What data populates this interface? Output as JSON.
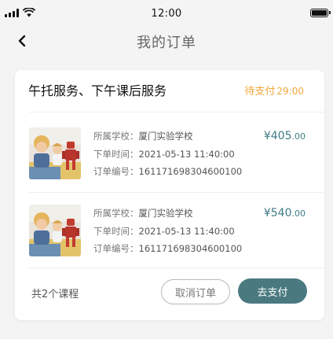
{
  "status_bar": {
    "time": "12:00"
  },
  "nav": {
    "title": "我的订单"
  },
  "order": {
    "title": "午托服务、下午课后服务",
    "status": "待支付",
    "countdown": "29:00",
    "courses": [
      {
        "school_label": "所属学校：",
        "school": "厦门实验学校",
        "time_label": "下单时间：",
        "time": "2021-05-13 11:40:00",
        "number_label": "订单编号：",
        "number": "161171698304600100",
        "price_main": "¥405",
        "price_cents": ".00",
        "image": "robot-kids-thumbnail"
      },
      {
        "school_label": "所属学校：",
        "school": "厦门实验学校",
        "time_label": "下单时间：",
        "time": "2021-05-13 11:40:00",
        "number_label": "订单编号：",
        "number": "161171698304600100",
        "price_main": "¥540",
        "price_cents": ".00",
        "image": "robot-kids-thumbnail"
      }
    ],
    "course_count": "共2个课程",
    "cancel_label": "取消订单",
    "pay_label": "去支付"
  },
  "icons": {
    "back": "chevron-left-icon",
    "signal": "signal-icon",
    "wifi": "wifi-icon",
    "battery": "battery-icon"
  },
  "colors": {
    "accent": "#4a7a80",
    "price": "#3e7d86",
    "pending": "#f2a83a"
  }
}
